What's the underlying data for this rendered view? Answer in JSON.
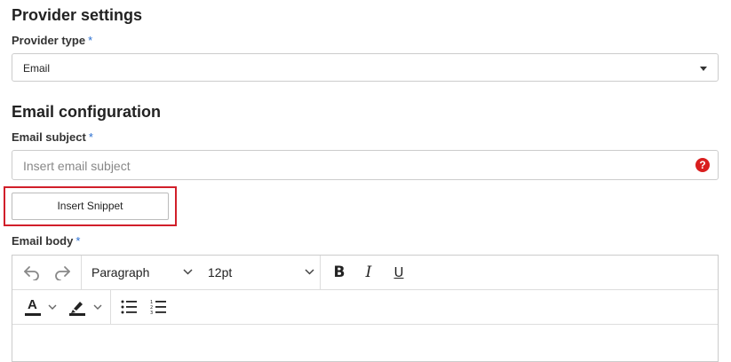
{
  "provider": {
    "section_title": "Provider settings",
    "type_label": "Provider type",
    "required_mark": "*",
    "type_value": "Email"
  },
  "email": {
    "section_title": "Email configuration",
    "subject_label": "Email subject",
    "subject_placeholder": "Insert email subject",
    "help_symbol": "?",
    "insert_snippet_label": "Insert Snippet",
    "body_label": "Email body",
    "required_mark": "*"
  },
  "editor": {
    "block_format": "Paragraph",
    "font_size": "12pt",
    "bold_glyph": "B",
    "italic_glyph": "I",
    "underline_glyph": "U",
    "text_color_glyph": "A"
  },
  "colors": {
    "required": "#2a6fd1",
    "highlight": "#d11f2a",
    "help_icon": "#d91e1e"
  }
}
